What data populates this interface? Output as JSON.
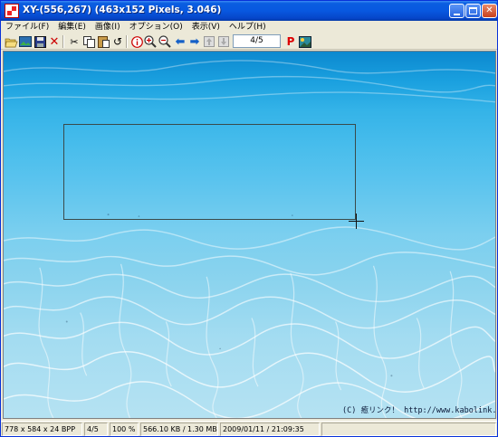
{
  "window": {
    "title": "XY-(556,267) (463x152 Pixels, 3.046)",
    "buttons": {
      "minimize": "minimize",
      "maximize": "maximize",
      "close": "✕"
    }
  },
  "menu": {
    "items": [
      "ファイル(F)",
      "編集(E)",
      "画像(I)",
      "オプション(O)",
      "表示(V)",
      "ヘルプ(H)"
    ]
  },
  "toolbar": {
    "page_indicator": "4/5",
    "icons": [
      "open-folder-icon",
      "image-icon",
      "save-icon",
      "delete-icon",
      "cut-icon",
      "copy-icon",
      "paste-icon",
      "undo-icon",
      "info-icon",
      "zoom-in-icon",
      "zoom-out-icon",
      "arrow-left-icon",
      "arrow-right-icon",
      "arrow-up-icon",
      "arrow-down-icon",
      "print-icon",
      "slideshow-icon"
    ]
  },
  "image": {
    "credit": "(C) 癒リンク！  http://www.kabolink.com"
  },
  "status": {
    "dimensions": "778 x 584 x 24 BPP",
    "page": "4/5",
    "zoom": "100 %",
    "memory": "566.10 KB / 1.30 MB",
    "datetime": "2009/01/11 / 21:09:35"
  },
  "colors": {
    "titlebar": "#0858e0",
    "chrome": "#ece9d8",
    "water_top": "#0c88cf",
    "water_bottom": "#b5e2f2"
  }
}
